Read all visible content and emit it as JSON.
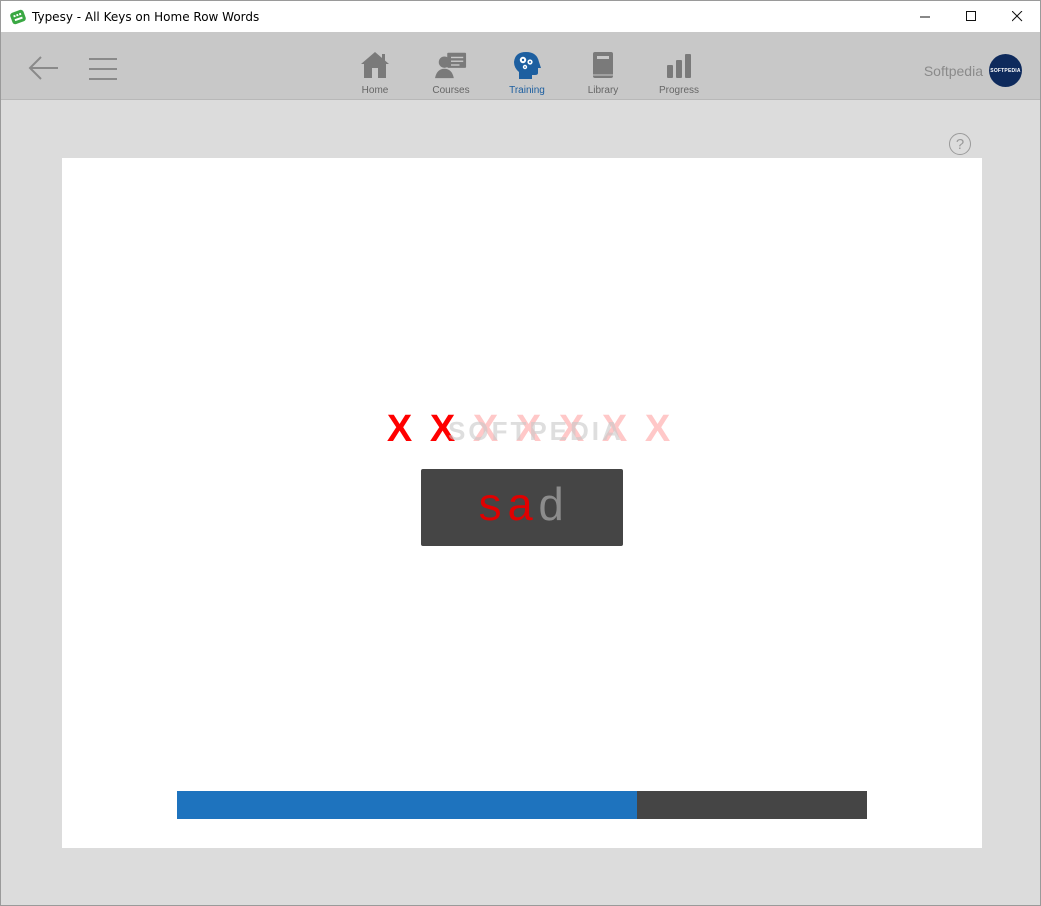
{
  "window": {
    "title": "Typesy - All Keys on Home Row Words",
    "minimize_label": "—",
    "maximize_label": "☐",
    "close_label": "✕"
  },
  "nav": {
    "items": [
      {
        "label": "Home",
        "icon": "home-icon",
        "active": false
      },
      {
        "label": "Courses",
        "icon": "courses-icon",
        "active": false
      },
      {
        "label": "Training",
        "icon": "training-icon",
        "active": true
      },
      {
        "label": "Library",
        "icon": "library-icon",
        "active": false
      },
      {
        "label": "Progress",
        "icon": "progress-icon",
        "active": false
      }
    ]
  },
  "user": {
    "name": "Softpedia",
    "avatar_text": "SOFTPEDIA"
  },
  "help": {
    "label": "?"
  },
  "exercise": {
    "marks": [
      "X",
      "X",
      "X",
      "X",
      "X",
      "X",
      "X"
    ],
    "marks_active": 2,
    "watermark": "SOFTPEDIA",
    "word_typed": "sa",
    "word_remaining": "d",
    "progress": 0.667
  },
  "colors": {
    "accent": "#1e73be",
    "error": "#ff0000",
    "error_faded": "#ffc8c8",
    "dark_box": "#454545"
  }
}
